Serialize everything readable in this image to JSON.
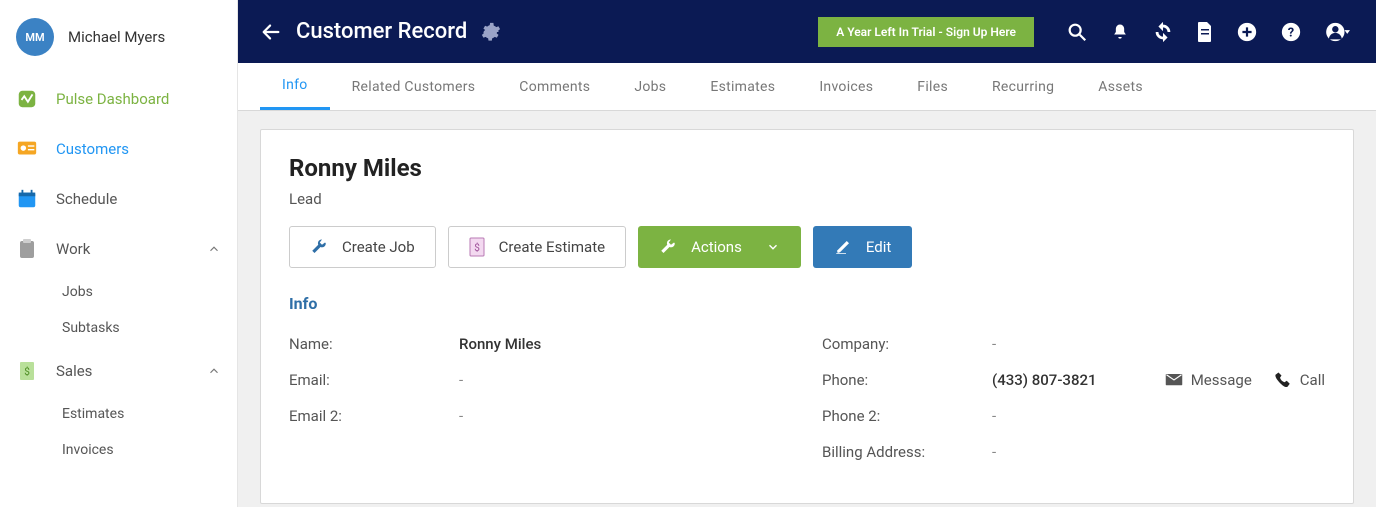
{
  "user": {
    "initials": "MM",
    "name": "Michael Myers"
  },
  "sidebar": {
    "pulse": "Pulse Dashboard",
    "customers": "Customers",
    "schedule": "Schedule",
    "work": "Work",
    "work_items": [
      "Jobs",
      "Subtasks"
    ],
    "sales": "Sales",
    "sales_items": [
      "Estimates",
      "Invoices"
    ]
  },
  "header": {
    "title": "Customer Record",
    "trial_cta": "A Year Left In Trial - Sign Up Here"
  },
  "tabs": [
    "Info",
    "Related Customers",
    "Comments",
    "Jobs",
    "Estimates",
    "Invoices",
    "Files",
    "Recurring",
    "Assets"
  ],
  "customer": {
    "name": "Ronny Miles",
    "status": "Lead",
    "btn_create_job": "Create Job",
    "btn_create_estimate": "Create Estimate",
    "btn_actions": "Actions",
    "btn_edit": "Edit",
    "section_info": "Info",
    "labels": {
      "name": "Name:",
      "email": "Email:",
      "email2": "Email 2:",
      "company": "Company:",
      "phone": "Phone:",
      "phone2": "Phone 2:",
      "billing": "Billing Address:"
    },
    "values": {
      "name": "Ronny Miles",
      "email": "-",
      "email2": "-",
      "company": "-",
      "phone": "(433) 807-3821",
      "phone2": "-",
      "billing": "-"
    },
    "contact": {
      "message": "Message",
      "call": "Call"
    }
  }
}
